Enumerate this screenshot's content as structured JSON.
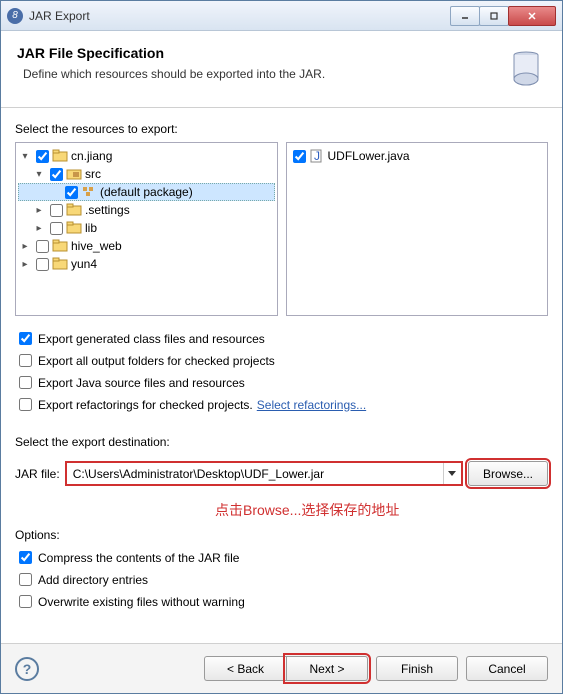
{
  "title": "JAR Export",
  "header": {
    "h1": "JAR File Specification",
    "sub": "Define which resources should be exported into the JAR."
  },
  "labels": {
    "select_resources": "Select the resources to export:",
    "select_dest": "Select the export destination:",
    "jar_file": "JAR file:",
    "options": "Options:"
  },
  "tree": {
    "cn_jiang": "cn.jiang",
    "src": "src",
    "default_pkg": "(default package)",
    "settings": ".settings",
    "lib": "lib",
    "hive_web": "hive_web",
    "yun4": "yun4"
  },
  "right_list": {
    "udflower": "UDFLower.java"
  },
  "opts": {
    "gen_class": "Export generated class files and resources",
    "all_output": "Export all output folders for checked projects",
    "java_src": "Export Java source files and resources",
    "refactor": "Export refactorings for checked projects.",
    "refactor_link": "Select refactorings...",
    "compress": "Compress the contents of the JAR file",
    "add_dir": "Add directory entries",
    "overwrite": "Overwrite existing files without warning"
  },
  "dest_value": "C:\\Users\\Administrator\\Desktop\\UDF_Lower.jar",
  "browse": "Browse...",
  "annotation": "点击Browse...选择保存的地址",
  "buttons": {
    "back": "< Back",
    "next": "Next >",
    "finish": "Finish",
    "cancel": "Cancel"
  }
}
